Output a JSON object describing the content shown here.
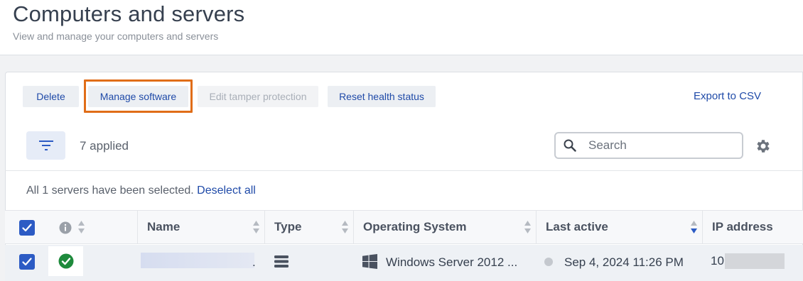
{
  "header": {
    "title": "Computers and servers",
    "subtitle": "View and manage your computers and servers"
  },
  "toolbar": {
    "delete_label": "Delete",
    "manage_software_label": "Manage software",
    "edit_tamper_label": "Edit tamper protection",
    "reset_health_label": "Reset health status",
    "export_label": "Export to CSV"
  },
  "filters": {
    "applied_text": "7 applied",
    "search_placeholder": "Search"
  },
  "selection": {
    "message": "All 1 servers have been selected.",
    "deselect_label": "Deselect all"
  },
  "table": {
    "columns": [
      "Name",
      "Type",
      "Operating System",
      "Last active",
      "IP address"
    ],
    "rows": [
      {
        "selected": true,
        "status_icon": "check-circle-icon",
        "name_suffix": ".",
        "type_icon": "server-icon",
        "os": "Windows Server 2012 ...",
        "last_active": "Sep 4, 2024 11:26 PM",
        "ip_prefix": "10."
      }
    ]
  },
  "colors": {
    "accent": "#1f4aa8",
    "checkbox": "#2c5bc4",
    "highlight": "#e06d18",
    "status_ok": "#1e8a3c"
  }
}
